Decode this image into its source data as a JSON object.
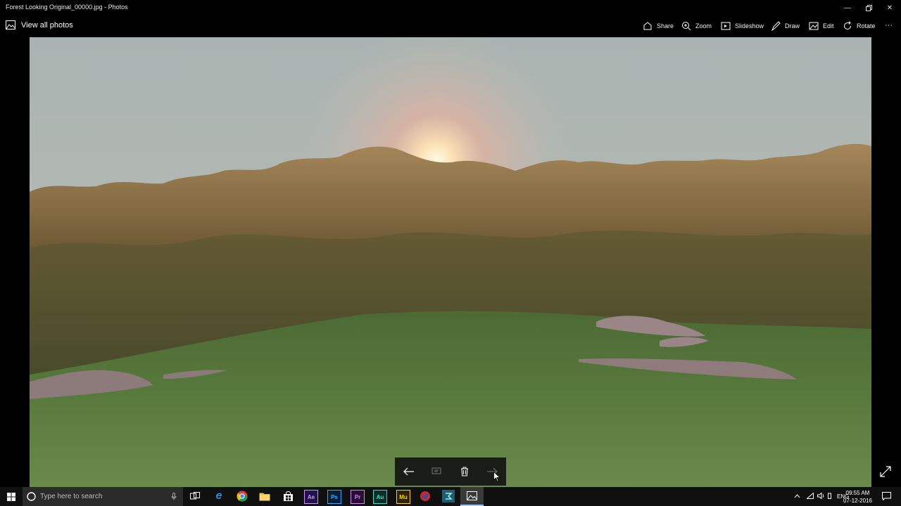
{
  "window": {
    "title": "Forest Looking Original_00000.jpg - Photos"
  },
  "appbar": {
    "view_all_label": "View all photos",
    "commands": [
      {
        "label": "Share",
        "icon": "share-icon"
      },
      {
        "label": "Zoom",
        "icon": "zoom-icon"
      },
      {
        "label": "Slideshow",
        "icon": "slideshow-icon"
      },
      {
        "label": "Draw",
        "icon": "draw-icon"
      },
      {
        "label": "Edit",
        "icon": "edit-icon"
      },
      {
        "label": "Rotate",
        "icon": "rotate-icon"
      }
    ],
    "more_label": "···"
  },
  "taskbar": {
    "search_placeholder": "Type here to search",
    "apps": [
      {
        "name": "task-view-icon",
        "label": ""
      },
      {
        "name": "edge-icon",
        "label": "e"
      },
      {
        "name": "chrome-icon",
        "label": ""
      },
      {
        "name": "file-explorer-icon",
        "label": ""
      },
      {
        "name": "store-icon",
        "label": ""
      },
      {
        "name": "after-effects-icon",
        "label": "Ae"
      },
      {
        "name": "photoshop-icon",
        "label": "Ps"
      },
      {
        "name": "premiere-icon",
        "label": "Pr"
      },
      {
        "name": "audition-icon",
        "label": "Au"
      },
      {
        "name": "muse-icon",
        "label": "Mu"
      },
      {
        "name": "app-icon",
        "label": ""
      },
      {
        "name": "app-icon-2",
        "label": ""
      },
      {
        "name": "photos-icon",
        "label": ""
      }
    ],
    "language": "ENG",
    "time": "09:55 AM",
    "date": "07-12-2016"
  },
  "colors": {
    "accent": "#0078d7",
    "taskbar": "#101010"
  }
}
